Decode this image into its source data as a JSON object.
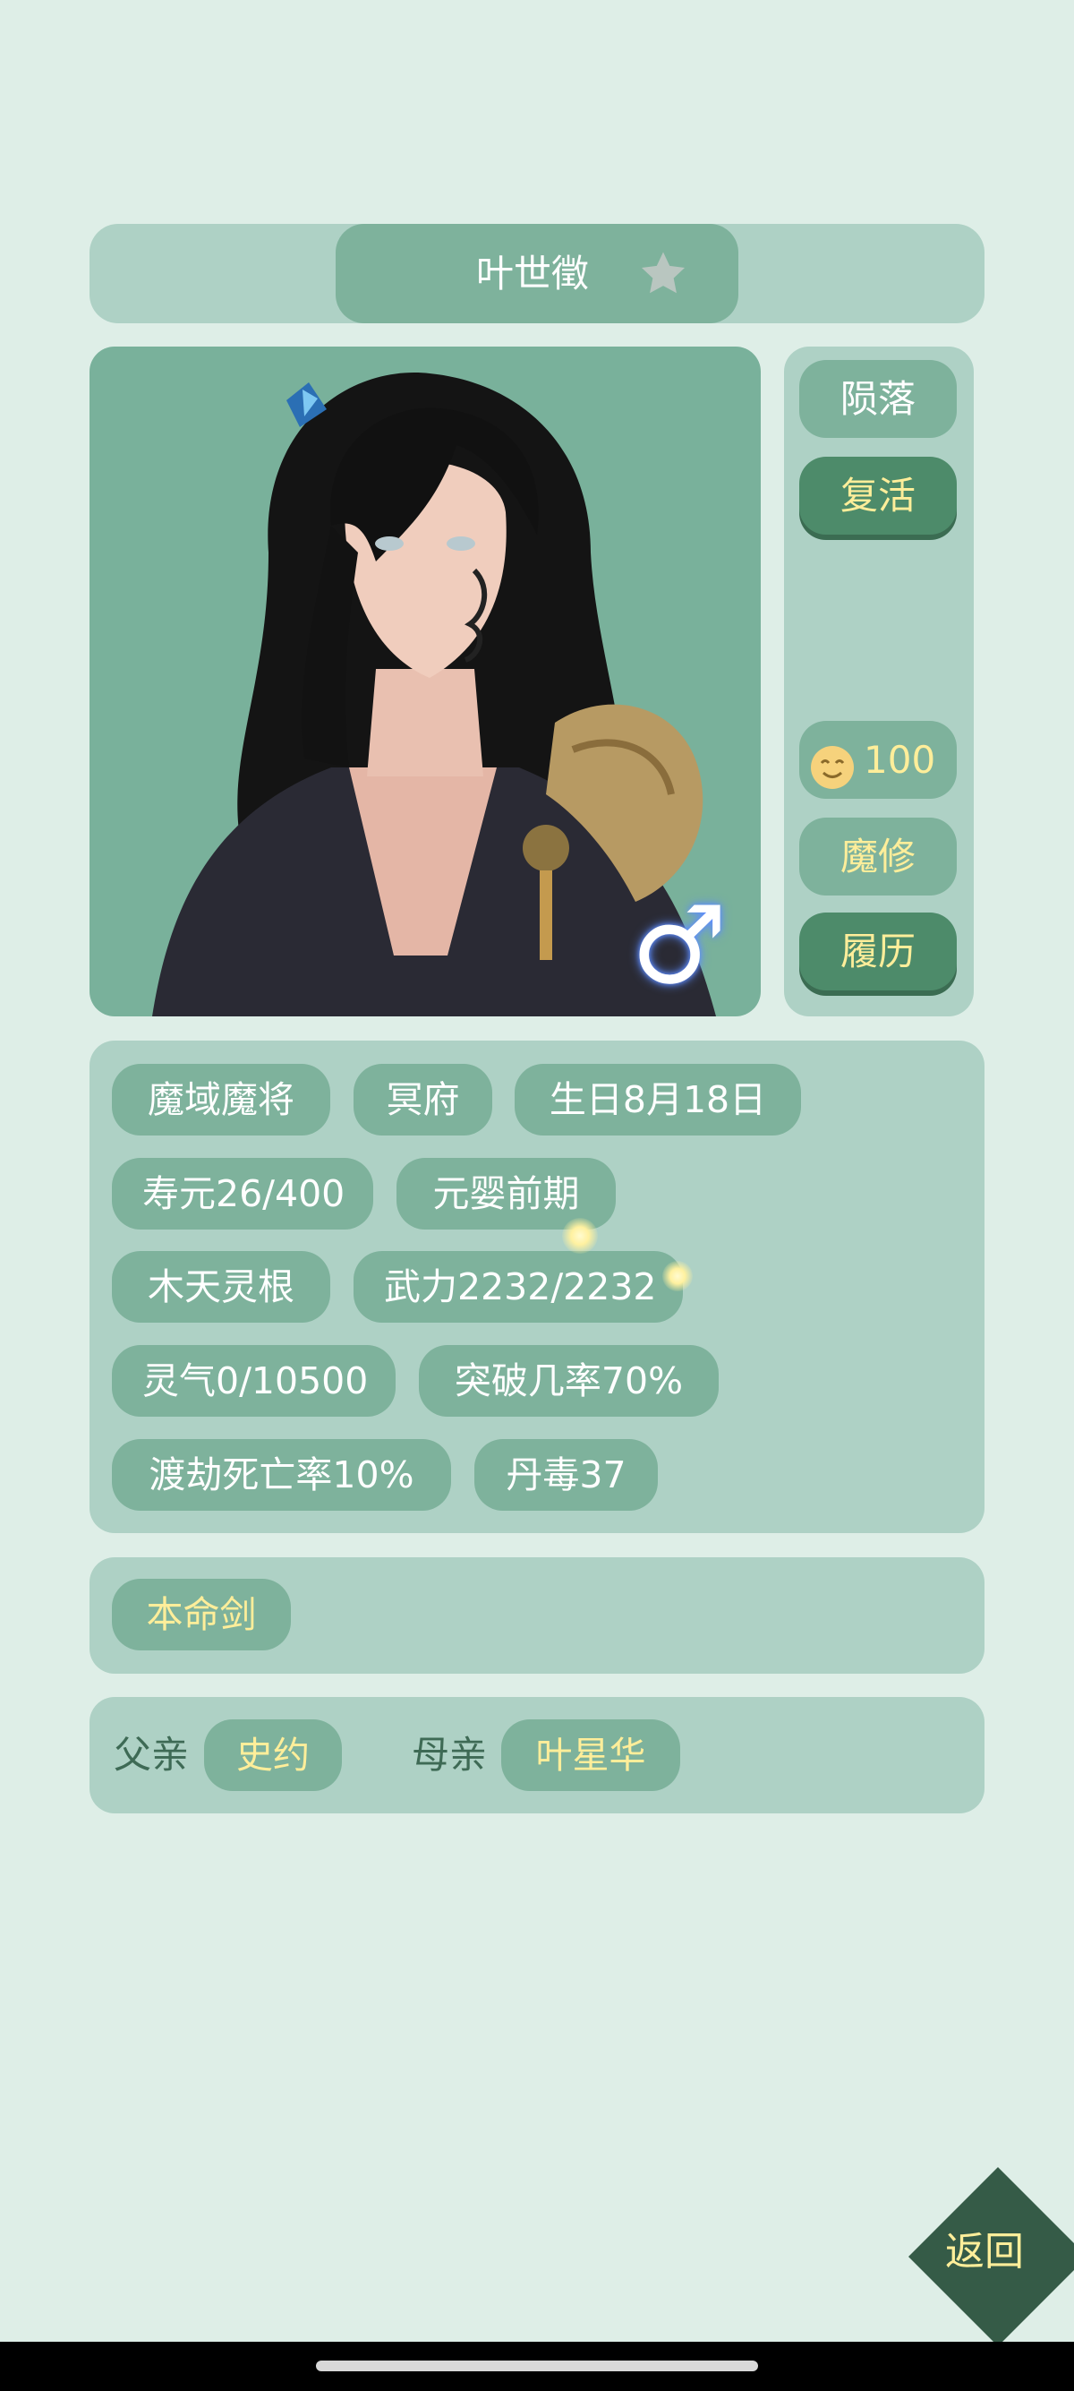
{
  "character": {
    "name": "叶世徵",
    "gender_symbol": "♂"
  },
  "side_buttons": {
    "fallen": "陨落",
    "revive": "复活",
    "mood_value": "100",
    "cultivation": "魔修",
    "history": "履历"
  },
  "stats": {
    "rows": [
      [
        "魔域魔将",
        "冥府",
        "生日8月18日"
      ],
      [
        "寿元26/400",
        "元婴前期"
      ],
      [
        "木天灵根",
        "武力2232/2232"
      ],
      [
        "灵气0/10500",
        "突破几率70%"
      ],
      [
        "渡劫死亡率10%",
        "丹毒37"
      ]
    ]
  },
  "weapon": {
    "label": "本命剑"
  },
  "family": {
    "father_label": "父亲",
    "father_name": "史约",
    "mother_label": "母亲",
    "mother_name": "叶星华"
  },
  "nav": {
    "back_label": "返回"
  },
  "colors": {
    "background": "#deeee7",
    "panel": "#aed1c5",
    "chip": "#7eb29c",
    "accent_yellow": "#ffee9a",
    "dark_green": "#355b47"
  },
  "icons": {
    "favorite": "star-icon",
    "mood": "smiley-icon",
    "gender": "male-symbol-icon"
  }
}
